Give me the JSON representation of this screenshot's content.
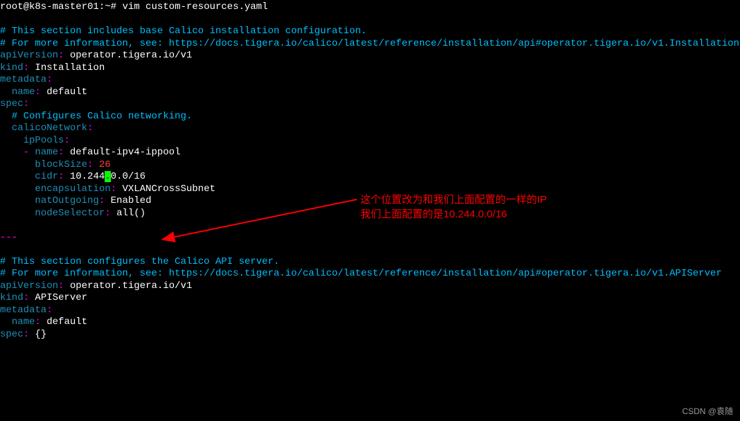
{
  "prompt": {
    "user_host": "root@k8s-master01",
    "path": ":~#",
    "command": "vim custom-resources.yaml"
  },
  "yaml": {
    "comment1": "# This section includes base Calico installation configuration.",
    "comment2": "# For more information, see: https://docs.tigera.io/calico/latest/reference/installation/api#operator.tigera.io/v1.Installation",
    "apiVersion_key": "apiVersion",
    "apiVersion_val": "operator.tigera.io/v1",
    "kind_key": "kind",
    "kind1_val": "Installation",
    "metadata_key": "metadata",
    "name_key": "name",
    "default_val": "default",
    "spec_key": "spec",
    "comment3": "# Configures Calico networking.",
    "calicoNetwork_key": "calicoNetwork",
    "ipPools_key": "ipPools",
    "dash": "-",
    "ippool_name_val": "default-ipv4-ippool",
    "blockSize_key": "blockSize",
    "blockSize_val": "26",
    "cidr_key": "cidr",
    "cidr_pre": "10.244",
    "cidr_cursor": ".",
    "cidr_post": "0.0/16",
    "encapsulation_key": "encapsulation",
    "encapsulation_val": "VXLANCrossSubnet",
    "natOutgoing_key": "natOutgoing",
    "natOutgoing_val": "Enabled",
    "nodeSelector_key": "nodeSelector",
    "nodeSelector_val": "all()",
    "separator": "---",
    "comment4": "# This section configures the Calico API server.",
    "comment5": "# For more information, see: https://docs.tigera.io/calico/latest/reference/installation/api#operator.tigera.io/v1.APIServer",
    "kind2_val": "APIServer",
    "spec_empty": "{}"
  },
  "annotation": {
    "line1": "这个位置改为和我们上面配置的一样的IP",
    "line2": "我们上面配置的是10.244.0.0/16"
  },
  "watermark": "CSDN @袁随"
}
